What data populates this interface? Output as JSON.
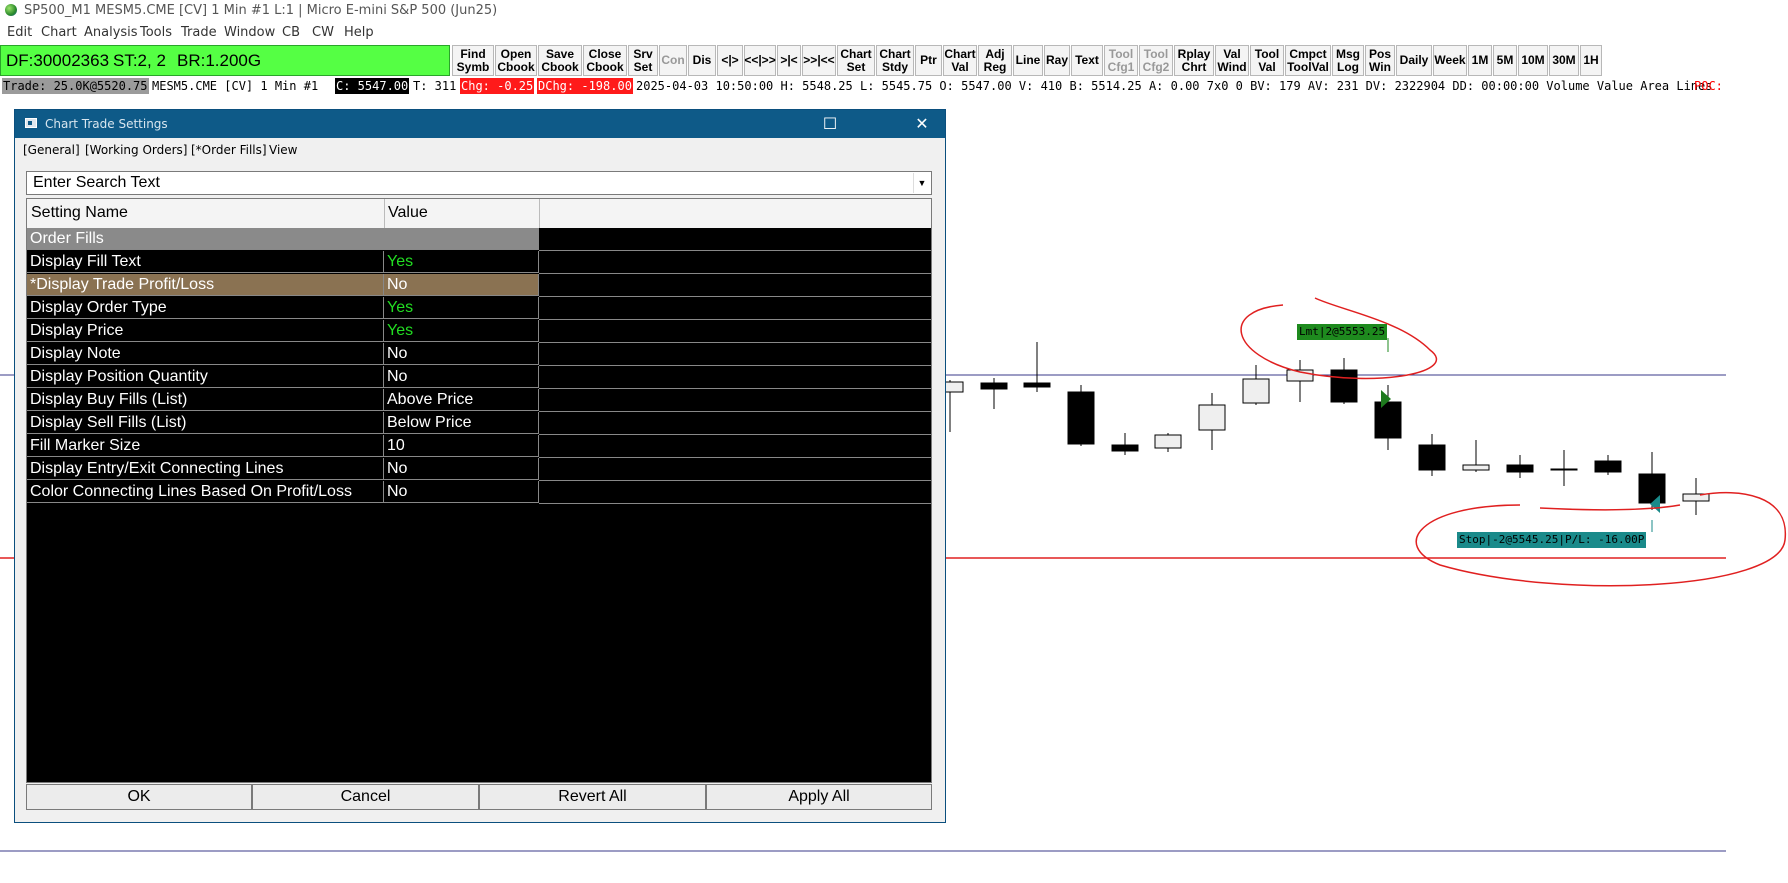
{
  "window": {
    "title": "SP500_M1 MESM5.CME [CV]  1 Min  #1 L:1 | Micro E-mini S&P 500 (Jun25)"
  },
  "menu": [
    "Edit",
    "Chart",
    "Analysis",
    "Tools",
    "Trade",
    "Window",
    "CB",
    "CW",
    "Help"
  ],
  "dfbar": {
    "df": "DF:30002363",
    "st": "ST:2, 2",
    "br": "BR:1.200G"
  },
  "toolbar": [
    "Find\nSymb",
    "Open\nCbook",
    "Save\nCbook",
    "Close\nCbook",
    "Srv\nSet",
    "Con",
    "Dis",
    "<|>",
    "<<|>>",
    ">|<",
    ">>|<<",
    "Chart\nSet",
    "Chart\nStdy",
    "Ptr",
    "Chart\nVal",
    "Adj\nReg",
    "Line",
    "Ray",
    "Text",
    "Tool\nCfg1",
    "Tool\nCfg2",
    "Rplay\nChrt",
    "Val\nWind",
    "Tool\nVal",
    "Cmpct\nToolVal",
    "Msg\nLog",
    "Pos\nWin",
    "Daily",
    "Week",
    "1M",
    "5M",
    "10M",
    "30M",
    "1H"
  ],
  "toolbar_disabled": [
    "Con",
    "Tool\nCfg1",
    "Tool\nCfg2"
  ],
  "status": {
    "trade": "Trade: 25.0K@5520.75",
    "symbol": "MESM5.CME [CV]  1 Min  #1",
    "close": "C: 5547.00",
    "ticks": "T: 311",
    "chg": "Chg: -0.25",
    "dchg": "DChg: -198.00",
    "rest": "2025-04-03  10:50:00  H: 5548.25  L: 5545.75  O: 5547.00  V: 410  B: 5514.25  A: 0.00  7x0 0  BV: 179  AV: 231  DV: 2322904  DD: 00:00:00  Volume Value Area Lines",
    "poc": "POC:"
  },
  "chart": {
    "limit_label": "Lmt|2@5553.25",
    "stop_label": "Stop|-2@5545.25|P/L: -16.00P",
    "colors": {
      "limit": "#1e8a1e",
      "stop": "#1a8a8a",
      "hline_blue": "#3a3a8a",
      "hline_red": "#e02020",
      "annotation": "#e02020"
    }
  },
  "dialog": {
    "title": "Chart Trade Settings",
    "tabs": [
      "[General]",
      "[Working Orders]",
      "[*Order Fills]",
      "View"
    ],
    "search_placeholder": "Enter Search Text",
    "columns": [
      "Setting Name",
      "Value"
    ],
    "group": "Order Fills",
    "rows": [
      {
        "name": "Display Fill Text",
        "value": "Yes"
      },
      {
        "name": "*Display Trade Profit/Loss",
        "value": "No"
      },
      {
        "name": "Display Order Type",
        "value": "Yes"
      },
      {
        "name": "Display Price",
        "value": "Yes"
      },
      {
        "name": "Display Note",
        "value": "No"
      },
      {
        "name": "Display Position Quantity",
        "value": "No"
      },
      {
        "name": "Display Buy Fills (List)",
        "value": "Above Price"
      },
      {
        "name": "Display Sell Fills (List)",
        "value": "Below Price"
      },
      {
        "name": "Fill Marker Size",
        "value": "10"
      },
      {
        "name": "Display Entry/Exit Connecting Lines",
        "value": "No"
      },
      {
        "name": "Color Connecting Lines Based On Profit/Loss",
        "value": "No"
      }
    ],
    "buttons": [
      "OK",
      "Cancel",
      "Revert All",
      "Apply All"
    ]
  }
}
